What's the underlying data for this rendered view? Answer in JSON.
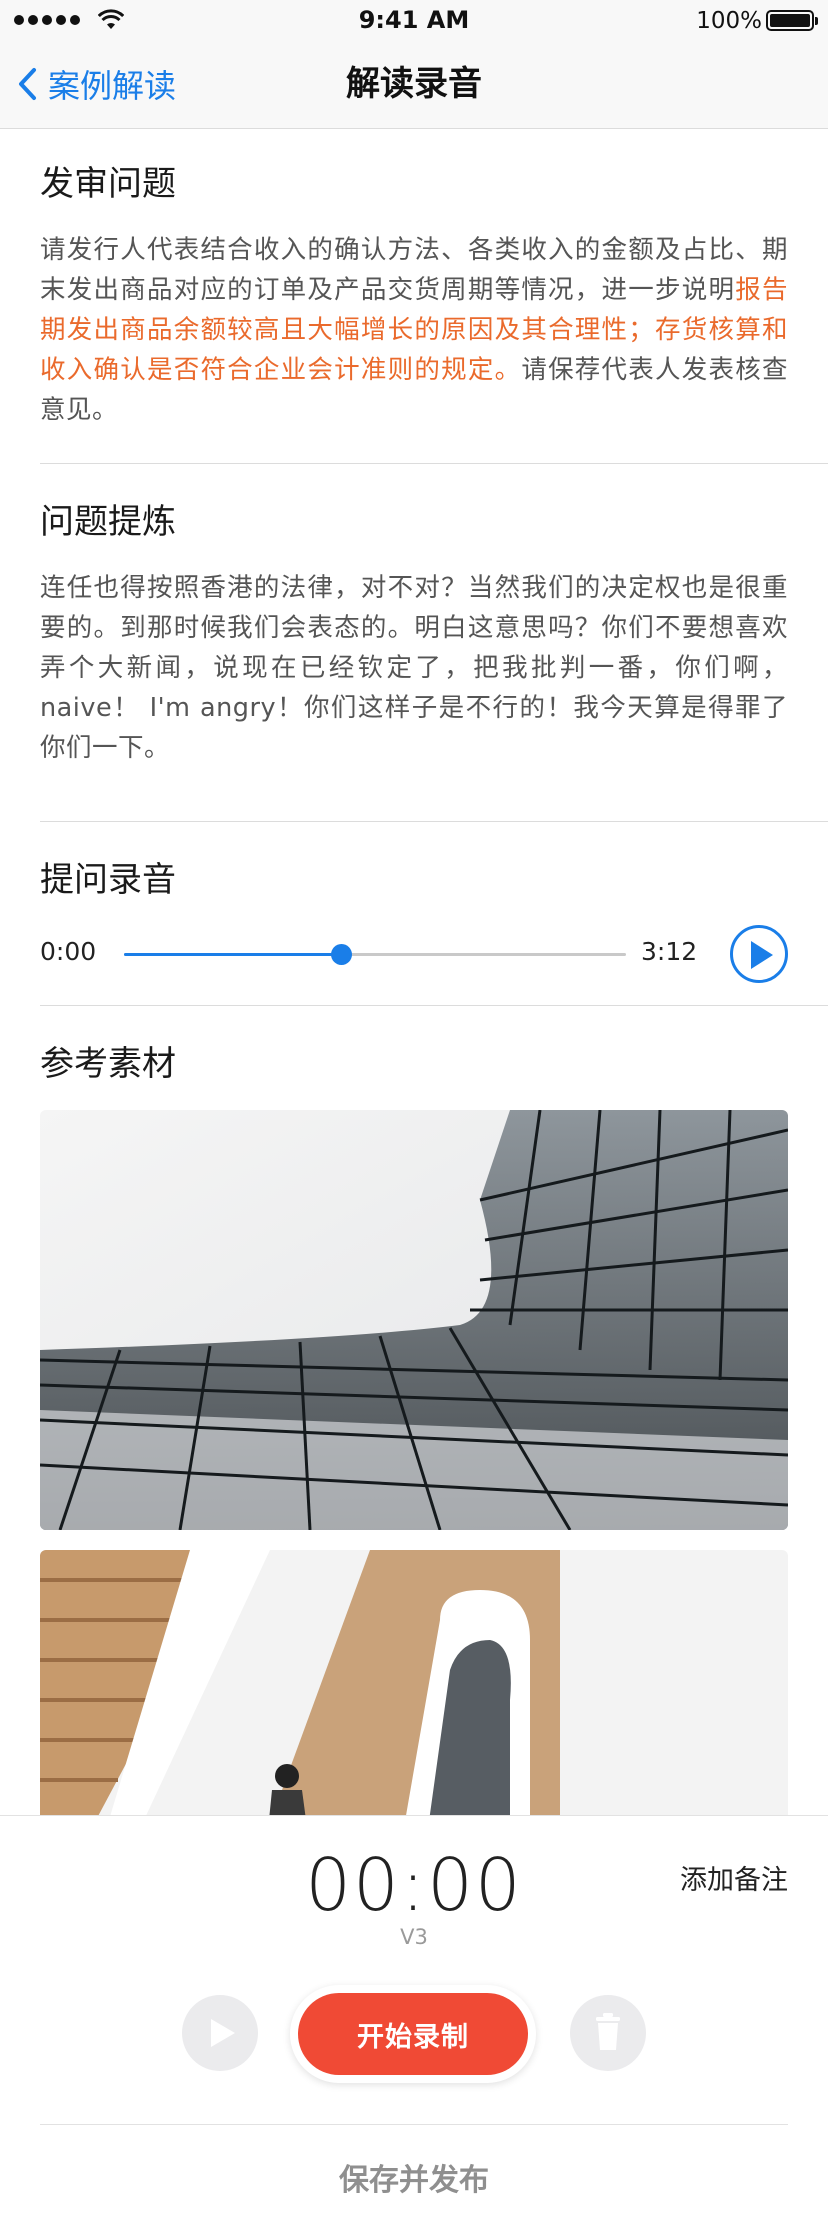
{
  "status_bar": {
    "time": "9:41 AM",
    "battery_text": "100%",
    "signal_icon": "signal-dots-icon",
    "wifi_icon": "wifi-icon",
    "battery_icon": "battery-icon"
  },
  "nav": {
    "back_label": "案例解读",
    "back_icon": "chevron-left-icon",
    "title": "解读录音"
  },
  "sections": {
    "review_question": {
      "title": "发审问题",
      "text_before": "请发行人代表结合收入的确认方法、各类收入的金额及占比、期末发出商品对应的订单及产品交货周期等情况，进一步说明",
      "text_highlight": "报告期发出商品余额较高且大幅增长的原因及其合理性；存货核算和收入确认是否符合企业会计准则的规定。",
      "text_after": "请保荐代表人发表核查意见。"
    },
    "question_refine": {
      "title": "问题提炼",
      "text": "连任也得按照香港的法律，对不对？当然我们的决定权也是很重要的。到那时候我们会表态的。明白这意思吗？你们不要想喜欢弄个大新闻，说现在已经钦定了，把我批判一番，你们啊，naive！ I'm angry！你们这样子是不行的！我今天算是得罪了你们一下。"
    },
    "recording": {
      "title": "提问录音",
      "current_time": "0:00",
      "total_time": "3:12",
      "progress": 0.433,
      "play_icon": "play-circle-icon"
    },
    "materials": {
      "title": "参考素材"
    }
  },
  "recorder": {
    "timer": "00:00",
    "version": "V3",
    "add_note": "添加备注",
    "record_label": "开始录制",
    "play_icon": "play-icon",
    "delete_icon": "trash-icon",
    "publish_label": "保存并发布"
  },
  "colors": {
    "accent_blue": "#1a7ee8",
    "highlight_orange": "#ea6a2c",
    "record_red": "#f04a35"
  }
}
